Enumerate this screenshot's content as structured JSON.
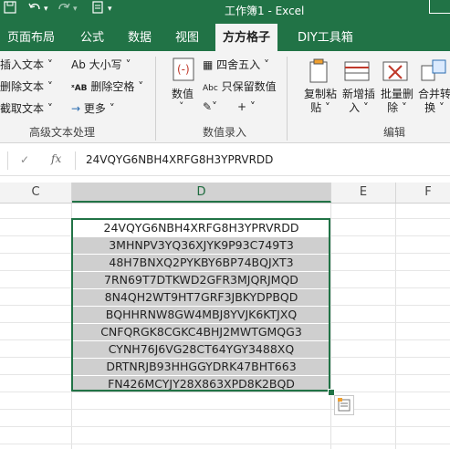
{
  "titlebar": {
    "save_icon": "save-icon",
    "undo_icon": "undo-icon",
    "redo_icon": "redo-icon",
    "title": "工作簿1  -  Excel"
  },
  "tabs": [
    {
      "label": "页面布局"
    },
    {
      "label": "公式"
    },
    {
      "label": "数据"
    },
    {
      "label": "视图"
    },
    {
      "label": "方方格子"
    },
    {
      "label": "DIY工具箱"
    }
  ],
  "ribbon": {
    "group1": {
      "items": [
        "插入文本 ˅",
        "删除文本 ˅",
        "截取文本 ˅"
      ],
      "items_b": [
        "Ab 大小写 ˅",
        "删除空格 ˅",
        "更多 ˅"
      ],
      "label": "高级文本处理"
    },
    "group2": {
      "number_label": "数值",
      "round_label": "四舍五入 ˅",
      "keep_value_label": "只保留数值",
      "abc_label": "Abc",
      "plus_label": "+ ˅",
      "label": "数值录入"
    },
    "group3": {
      "copy_paste": "复制粘贴 ˅",
      "add_insert": "新增插入 ˅",
      "batch_delete": "批量删除 ˅",
      "merge_convert": "合并转换 ˅",
      "label": "编辑"
    }
  },
  "formula_bar": {
    "check_icon": "checkmark-icon",
    "fx_label": "fx",
    "value": "24VQYG6NBH4XRFG8H3YPRVRDD"
  },
  "columns": [
    "C",
    "D",
    "E",
    "F"
  ],
  "cells": [
    "24VQYG6NBH4XRFG8H3YPRVRDD",
    "3MHNPV3YQ36XJYK9P93C749T3",
    "48H7BNXQ2PYKBY6BP74BQJXT3",
    "7RN69T7DTKWD2GFR3MJQRJMQD",
    "8N4QH2WT9HT7GRF3JBKYDPBQD",
    "BQHHRNW8GW4MBJ8YVJK6KTJXQ",
    "CNFQRGK8CGKC4BHJ2MWTGMQG3",
    "CYNH76J6VG28CT64YGY3488XQ",
    "DRTNRJB93HHGGYDRK47BHT663",
    "FN426MCYJY28X863XPD8K2BQD"
  ],
  "colors": {
    "excel_green": "#217346",
    "selection_fill": "#cfcfcf",
    "ribbon_bg": "#f3f3f3"
  }
}
